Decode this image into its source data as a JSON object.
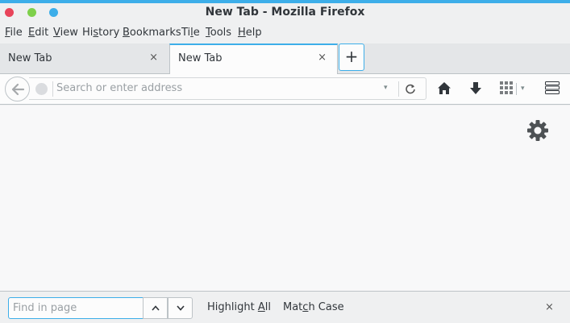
{
  "window": {
    "title": "New Tab - Mozilla Firefox",
    "accent_color": "#3daee9"
  },
  "menubar": {
    "items": [
      {
        "pre": "",
        "key": "F",
        "post": "ile"
      },
      {
        "pre": "",
        "key": "E",
        "post": "dit"
      },
      {
        "pre": "",
        "key": "V",
        "post": "iew"
      },
      {
        "pre": "Hi",
        "key": "s",
        "post": "tory"
      },
      {
        "pre": "",
        "key": "B",
        "post": "ookmarks"
      },
      {
        "pre": "Ti",
        "key": "l",
        "post": "e"
      },
      {
        "pre": "",
        "key": "T",
        "post": "ools"
      },
      {
        "pre": "",
        "key": "H",
        "post": "elp"
      }
    ]
  },
  "tabs": [
    {
      "label": "New Tab",
      "close": "×",
      "active": false
    },
    {
      "label": "New Tab",
      "close": "×",
      "active": true
    }
  ],
  "new_tab_button": {
    "label": "+"
  },
  "navbar": {
    "url_placeholder": "Search or enter address",
    "url_value": "",
    "dropdown_glyph": "▾",
    "icons": [
      "back-arrow-icon",
      "globe-icon",
      "reload-icon",
      "home-icon",
      "download-icon",
      "tiles-icon",
      "hamburger-menu-icon"
    ]
  },
  "content": {
    "icons": [
      "gear-icon"
    ]
  },
  "findbar": {
    "placeholder": "Find in page",
    "highlight_all": {
      "pre": "Highlight ",
      "key": "A",
      "post": "ll"
    },
    "match_case": {
      "pre": "Mat",
      "key": "c",
      "post": "h Case"
    },
    "close": "×"
  }
}
